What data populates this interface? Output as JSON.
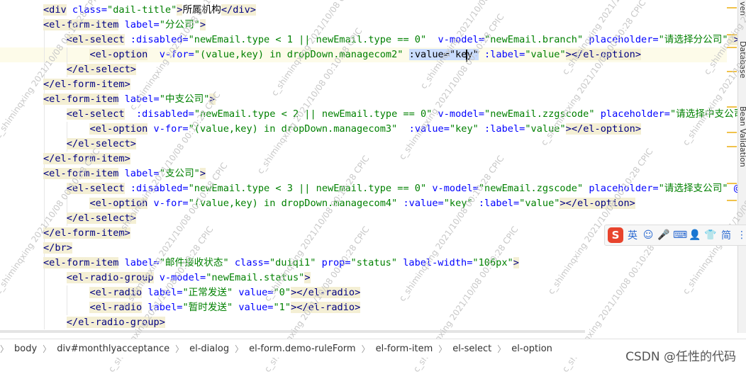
{
  "editor": {
    "lines": [
      [
        {
          "t": "tag",
          "v": "<div"
        },
        {
          "t": "attr",
          "v": " class="
        },
        {
          "t": "str",
          "v": "\"dail-title\""
        },
        {
          "t": "tag",
          "v": ">"
        },
        {
          "t": "txt",
          "v": "所属机构"
        },
        {
          "t": "tag",
          "v": "</div>"
        }
      ],
      [
        {
          "t": "tag",
          "v": "<el-form-item"
        },
        {
          "t": "attr",
          "v": " label="
        },
        {
          "t": "str",
          "v": "\"分公司\""
        },
        {
          "t": "tag",
          "v": ">"
        }
      ],
      [
        {
          "t": "txt",
          "v": "    "
        },
        {
          "t": "tag",
          "v": "<el-select"
        },
        {
          "t": "attr",
          "v": " :disabled="
        },
        {
          "t": "str",
          "v": "\"newEmail.type < 1 || newEmail.type == 0\""
        },
        {
          "t": "attr",
          "v": "  v-model="
        },
        {
          "t": "str",
          "v": "\"newEmail.branch\""
        },
        {
          "t": "attr",
          "v": " placeholder="
        },
        {
          "t": "str",
          "v": "\"请选择分公司\""
        },
        {
          "t": "tag",
          "v": " >"
        }
      ],
      [
        {
          "t": "txt",
          "v": "        "
        },
        {
          "t": "tag",
          "v": "<el-option"
        },
        {
          "t": "attr",
          "v": "  v-for="
        },
        {
          "t": "str",
          "v": "\"(value,key) in dropDown.managecom2\""
        },
        {
          "t": "txt",
          "v": " "
        },
        {
          "t": "sel",
          "v": ":value=\"key\""
        },
        {
          "t": "attr",
          "v": " :label="
        },
        {
          "t": "str",
          "v": "\"value\""
        },
        {
          "t": "tag",
          "v": "></el-option>"
        }
      ],
      [
        {
          "t": "txt",
          "v": "    "
        },
        {
          "t": "tag",
          "v": "</el-select>"
        }
      ],
      [
        {
          "t": "tag",
          "v": "</el-form-item>"
        }
      ],
      [
        {
          "t": "tag",
          "v": "<el-form-item"
        },
        {
          "t": "attr",
          "v": " label="
        },
        {
          "t": "str",
          "v": "\"中支公司\""
        },
        {
          "t": "tag",
          "v": ">"
        }
      ],
      [
        {
          "t": "txt",
          "v": "    "
        },
        {
          "t": "tag",
          "v": "<el-select"
        },
        {
          "t": "attr",
          "v": "  :disabled="
        },
        {
          "t": "str",
          "v": "\"newEmail.type < 2 || newEmail.type == 0\""
        },
        {
          "t": "attr",
          "v": " v-model="
        },
        {
          "t": "str",
          "v": "\"newEmail.zzgscode\""
        },
        {
          "t": "attr",
          "v": " placeholder="
        },
        {
          "t": "str",
          "v": "\"请选择中支公司\""
        }
      ],
      [
        {
          "t": "txt",
          "v": "        "
        },
        {
          "t": "tag",
          "v": "<el-option"
        },
        {
          "t": "attr",
          "v": " v-for="
        },
        {
          "t": "str",
          "v": "\"(value,key) in dropDown.managecom3\""
        },
        {
          "t": "attr",
          "v": "  :value="
        },
        {
          "t": "str",
          "v": "\"key\""
        },
        {
          "t": "attr",
          "v": " :label="
        },
        {
          "t": "str",
          "v": "\"value\""
        },
        {
          "t": "tag",
          "v": "></el-option>"
        }
      ],
      [
        {
          "t": "txt",
          "v": "    "
        },
        {
          "t": "tag",
          "v": "</el-select>"
        }
      ],
      [
        {
          "t": "tag",
          "v": "</el-form-item>"
        }
      ],
      [
        {
          "t": "tag",
          "v": "<el-form-item"
        },
        {
          "t": "attr",
          "v": " label="
        },
        {
          "t": "str",
          "v": "\"支公司\""
        },
        {
          "t": "tag",
          "v": ">"
        }
      ],
      [
        {
          "t": "txt",
          "v": "    "
        },
        {
          "t": "tag",
          "v": "<el-select"
        },
        {
          "t": "attr",
          "v": " :disabled="
        },
        {
          "t": "str",
          "v": "\"newEmail.type < 3 || newEmail.type == 0\""
        },
        {
          "t": "attr",
          "v": " v-model="
        },
        {
          "t": "str",
          "v": "\"newEmail.zgscode\""
        },
        {
          "t": "attr",
          "v": " placeholder="
        },
        {
          "t": "str",
          "v": "\"请选择支公司\""
        },
        {
          "t": "attr",
          "v": " @cli"
        }
      ],
      [
        {
          "t": "txt",
          "v": "        "
        },
        {
          "t": "tag",
          "v": "<el-option"
        },
        {
          "t": "attr",
          "v": " v-for="
        },
        {
          "t": "str",
          "v": "\"(value,key) in dropDown.managecom4\""
        },
        {
          "t": "attr",
          "v": " :value="
        },
        {
          "t": "str",
          "v": "\"key\""
        },
        {
          "t": "attr",
          "v": " :label="
        },
        {
          "t": "str",
          "v": "\"value\""
        },
        {
          "t": "tag",
          "v": "></el-option>"
        }
      ],
      [
        {
          "t": "txt",
          "v": "    "
        },
        {
          "t": "tag",
          "v": "</el-select>"
        }
      ],
      [
        {
          "t": "tag",
          "v": "</el-form-item>"
        }
      ],
      [
        {
          "t": "tag",
          "v": "</br>"
        }
      ],
      [
        {
          "t": "tag",
          "v": "<el-form-item"
        },
        {
          "t": "attr",
          "v": " label="
        },
        {
          "t": "str",
          "v": "\"邮件接收状态\""
        },
        {
          "t": "attr",
          "v": " class="
        },
        {
          "t": "str",
          "v": "\"duiqi1\""
        },
        {
          "t": "attr",
          "v": " prop="
        },
        {
          "t": "str",
          "v": "\"status\""
        },
        {
          "t": "attr",
          "v": " label-width="
        },
        {
          "t": "str",
          "v": "\"106px\""
        },
        {
          "t": "tag",
          "v": ">"
        }
      ],
      [
        {
          "t": "txt",
          "v": "    "
        },
        {
          "t": "tag",
          "v": "<el-radio-group"
        },
        {
          "t": "attr",
          "v": " v-model="
        },
        {
          "t": "str",
          "v": "\"newEmail.status\""
        },
        {
          "t": "tag",
          "v": ">"
        }
      ],
      [
        {
          "t": "txt",
          "v": "        "
        },
        {
          "t": "tag",
          "v": "<el-radio"
        },
        {
          "t": "attr",
          "v": " label="
        },
        {
          "t": "str",
          "v": "\"正常发送\""
        },
        {
          "t": "attr",
          "v": " value="
        },
        {
          "t": "str",
          "v": "\"0\""
        },
        {
          "t": "tag",
          "v": "></el-radio>"
        }
      ],
      [
        {
          "t": "txt",
          "v": "        "
        },
        {
          "t": "tag",
          "v": "<el-radio"
        },
        {
          "t": "attr",
          "v": " label="
        },
        {
          "t": "str",
          "v": "\"暂时发送\""
        },
        {
          "t": "attr",
          "v": " value="
        },
        {
          "t": "str",
          "v": "\"1\""
        },
        {
          "t": "tag",
          "v": "></el-radio>"
        }
      ],
      [
        {
          "t": "txt",
          "v": "    "
        },
        {
          "t": "tag",
          "v": "</el-radio-group>"
        }
      ],
      [
        {
          "t": "tag",
          "v": "</el-form-item>"
        }
      ]
    ]
  },
  "side_panels": [
    "Database",
    "Bean Validation"
  ],
  "side_panel_top_fragment": "ven",
  "ime": {
    "logo": "S",
    "items": [
      "英",
      "☺",
      "🎤",
      "⌨",
      "👤",
      "👕",
      "简",
      "⋮"
    ]
  },
  "breadcrumb": [
    "body",
    "div#monthlyacceptance",
    "el-dialog",
    "el-form.demo-ruleForm",
    "el-form-item",
    "el-select",
    "el-option"
  ],
  "watermark_text": "c_shiminqxing 2021/10/08 00:10:28 CPIC",
  "csdn_badge": "CSDN @任性的代码"
}
